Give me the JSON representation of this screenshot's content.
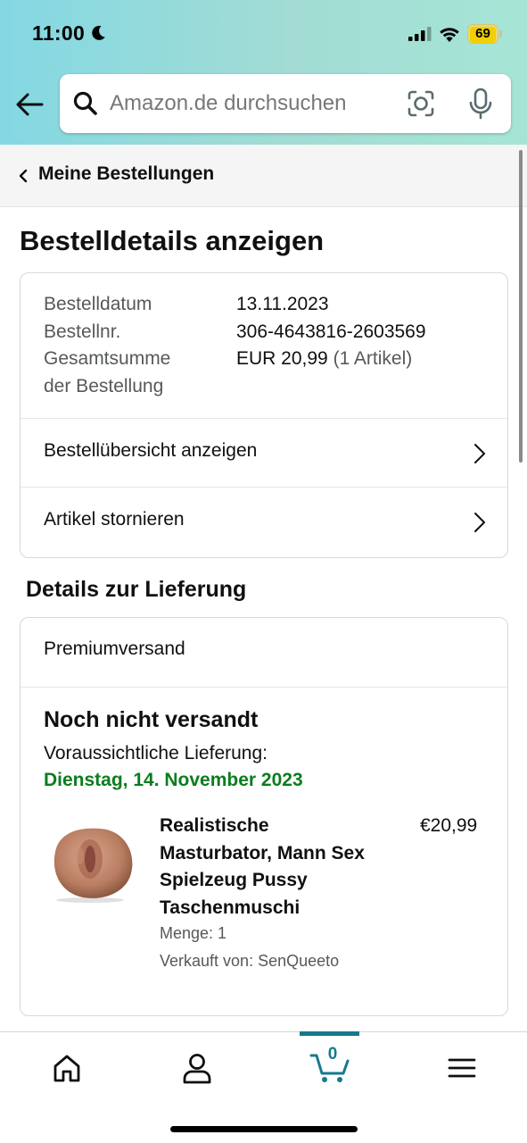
{
  "status_bar": {
    "time": "11:00",
    "battery": "69"
  },
  "search": {
    "placeholder": "Amazon.de durchsuchen"
  },
  "breadcrumb": {
    "label": "Meine Bestellungen"
  },
  "page": {
    "title": "Bestelldetails anzeigen"
  },
  "summary": {
    "order_date_label": "Bestelldatum",
    "order_date": "13.11.2023",
    "order_number_label": "Bestellnr.",
    "order_number": "306-4643816-2603569",
    "total_label_line1": "Gesamtsumme",
    "total_label_line2": "der Bestellung",
    "total_value": "EUR 20,99",
    "total_items": "(1 Artikel)",
    "actions": [
      {
        "label": "Bestellübersicht anzeigen"
      },
      {
        "label": "Artikel stornieren"
      }
    ]
  },
  "delivery": {
    "section_title": "Details zur Lieferung",
    "shipping_method": "Premiumversand",
    "status": "Noch nicht versandt",
    "estimate_label": "Voraussichtliche Lieferung:",
    "estimate_date": "Dienstag, 14. November 2023",
    "item": {
      "title": "Realistische Masturbator, Mann Sex Spielzeug Pussy Taschenmuschi",
      "price": "€20,99",
      "quantity": "Menge: 1",
      "seller": "Verkauft von: SenQueeto"
    }
  },
  "bottom_nav": {
    "cart_count": "0",
    "items": [
      "home-icon",
      "account-icon",
      "cart-icon",
      "menu-icon"
    ]
  },
  "colors": {
    "accent": "#157a8c",
    "delivery_green": "#0a7d1e"
  }
}
